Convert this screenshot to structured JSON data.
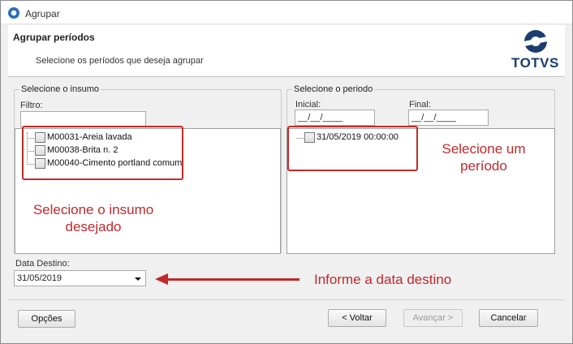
{
  "window": {
    "title": "Agrupar"
  },
  "header": {
    "title": "Agrupar períodos",
    "subtitle": "Selecione os períodos que deseja agrupar",
    "logo_text": "TOTVS"
  },
  "insumo": {
    "group_label": "Selecione o insumo",
    "filter_label": "Filtro:",
    "filter_value": "",
    "items": [
      {
        "label": "M00031-Areia lavada",
        "checked": false
      },
      {
        "label": "M00038-Brita n. 2",
        "checked": false
      },
      {
        "label": "M00040-Cimento portland comum",
        "checked": false
      }
    ]
  },
  "periodo": {
    "group_label": "Selecione o periodo",
    "inicial_label": "Inicial:",
    "inicial_value": "__/__/____",
    "final_label": "Final:",
    "final_value": "__/__/____",
    "items": [
      {
        "label": "31/05/2019 00:00:00",
        "checked": false
      }
    ]
  },
  "destino": {
    "label": "Data Destino:",
    "value": "31/05/2019"
  },
  "annotations": {
    "insumo": "Selecione o insumo desejado",
    "periodo": "Selecione um período",
    "destino": "Informe a data destino"
  },
  "buttons": {
    "opcoes": "Opções",
    "voltar": "< Voltar",
    "avancar": "Avançar >",
    "cancelar": "Cancelar"
  },
  "colors": {
    "annotation": "#c0292b",
    "brand": "#1b3d6e"
  }
}
